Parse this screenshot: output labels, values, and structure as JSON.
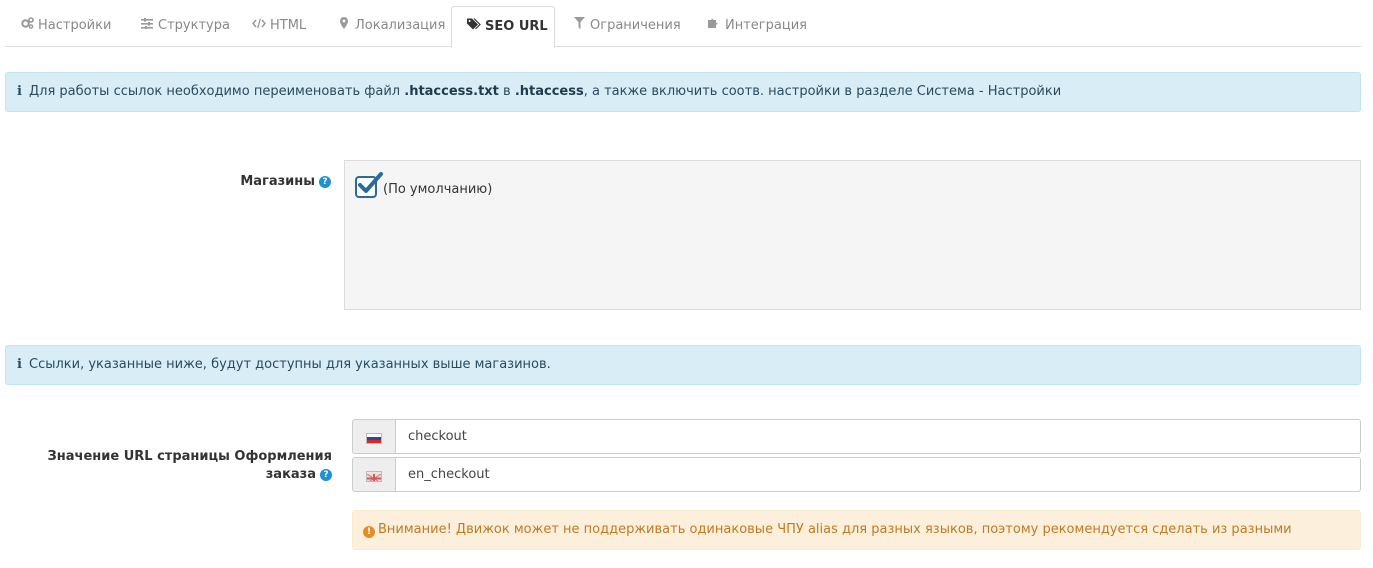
{
  "tabs": [
    {
      "label": "Настройки",
      "icon": "gears-icon"
    },
    {
      "label": "Структура",
      "icon": "sliders-icon"
    },
    {
      "label": "HTML",
      "icon": "code-icon"
    },
    {
      "label": "Локализация",
      "icon": "map-marker-icon"
    },
    {
      "label": "SEO URL",
      "icon": "tags-icon",
      "active": true
    },
    {
      "label": "Ограничения",
      "icon": "filter-icon"
    },
    {
      "label": "Интеграция",
      "icon": "puzzle-icon"
    }
  ],
  "alert_top": {
    "part1": "Для работы ссылок необходимо переименовать файл ",
    "file1": ".htaccess.txt",
    "part2": " в ",
    "file2": ".htaccess",
    "part3": ", а также включить соотв. настройки в разделе Система - Настройки"
  },
  "stores": {
    "label": "Магазины",
    "default_store": "(По умолчанию)",
    "checked": true
  },
  "alert_mid": {
    "text": "Ссылки, указанные ниже, будут доступны для указанных выше магазинов."
  },
  "seo": {
    "label_line1": "Значение URL страницы Оформления",
    "label_line2": "заказа",
    "ru_value": "checkout",
    "en_value": "en_checkout"
  },
  "warning": {
    "text": "Внимание! Движок может не поддерживать одинаковые ЧПУ alias для разных языков, поэтому рекомендуется сделать из разными"
  },
  "colors": {
    "info_bg": "#d9edf7",
    "warn_bg": "#fcf0dc",
    "help_blue": "#1e91cf",
    "check_blue": "#2d6a99"
  }
}
